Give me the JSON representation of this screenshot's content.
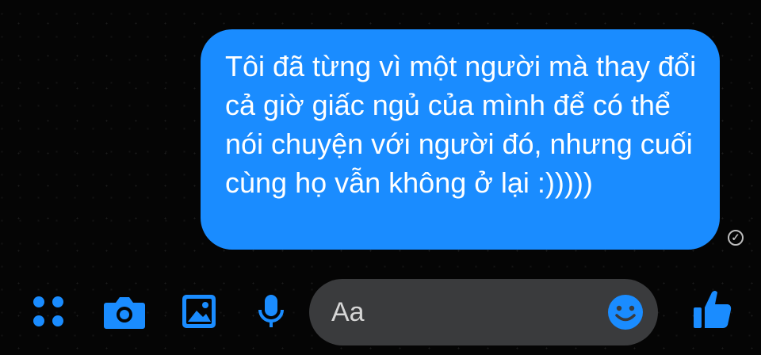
{
  "message": {
    "text": "Tôi đã từng vì một người mà thay đổi cả giờ giấc ngủ của mình để có thể nói chuyện với người đó, nhưng cuối cùng họ vẫn không ở lại :)))))",
    "status_icon": "check-circle-icon"
  },
  "composer": {
    "placeholder": "Aa"
  },
  "toolbar": {
    "icons": [
      "apps-icon",
      "camera-icon",
      "image-icon",
      "microphone-icon",
      "emoji-icon",
      "thumbs-up-icon"
    ]
  },
  "colors": {
    "accent": "#1a8cff",
    "background": "#050505",
    "composer_bg": "#3a3b3d",
    "bubble_text": "#ffffff",
    "receipt": "#bdbdbd"
  }
}
